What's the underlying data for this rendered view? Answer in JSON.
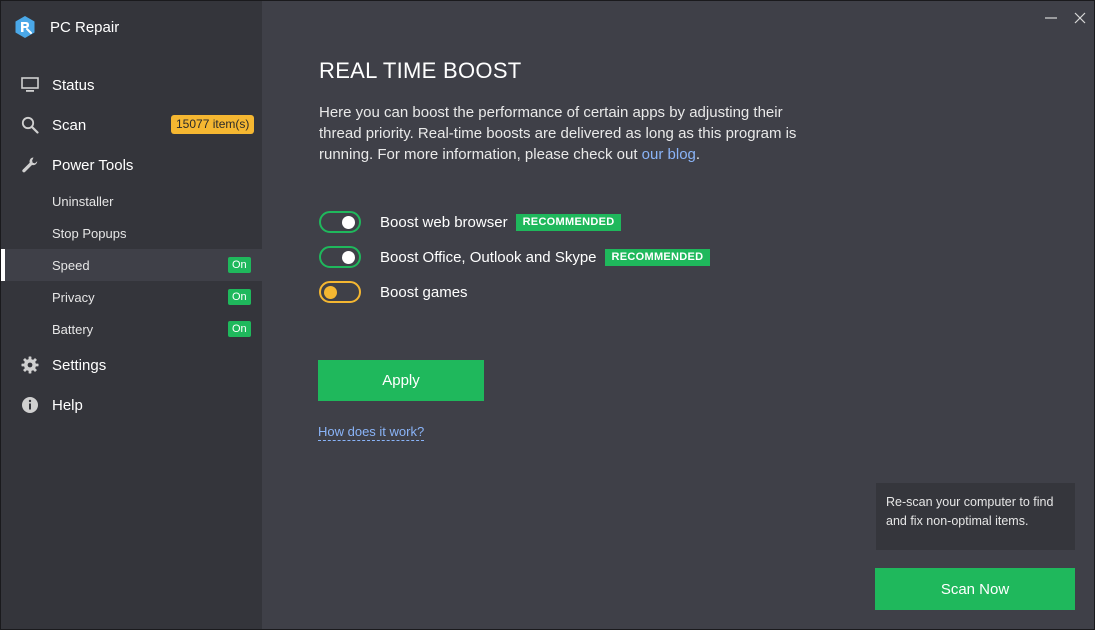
{
  "app": {
    "name": "PC Repair",
    "logo_icon": "pc-repair-logo-icon"
  },
  "sidebar": {
    "status_label": "Status",
    "scan_label": "Scan",
    "scan_badge": "15077 item(s)",
    "power_tools_label": "Power Tools",
    "sub_items": [
      {
        "label": "Uninstaller"
      },
      {
        "label": "Stop Popups"
      },
      {
        "label": "Speed",
        "badge": "On"
      },
      {
        "label": "Privacy",
        "badge": "On"
      },
      {
        "label": "Battery",
        "badge": "On"
      }
    ],
    "settings_label": "Settings",
    "help_label": "Help"
  },
  "main": {
    "title": "REAL TIME BOOST",
    "description": "Here you can boost the performance of certain apps by adjusting their thread priority. Real-time boosts are delivered as long as this program is running. For more information, please check out ",
    "blog_link": "our blog",
    "description_end": ".",
    "toggles": [
      {
        "label": "Boost web browser",
        "badge": "RECOMMENDED",
        "state": "on"
      },
      {
        "label": "Boost Office, Outlook and Skype",
        "badge": "RECOMMENDED",
        "state": "on"
      },
      {
        "label": "Boost games",
        "state": "off"
      }
    ],
    "apply_label": "Apply",
    "how_link": "How does it work?"
  },
  "rescan": {
    "text": "Re-scan your computer to find and fix non-optimal items.",
    "button_label": "Scan Now"
  },
  "colors": {
    "accent_green": "#1fb85c",
    "warning_yellow": "#f5b731",
    "link_blue": "#8ab4f8",
    "sidebar_bg": "#34353b",
    "main_bg": "#3f4048"
  }
}
